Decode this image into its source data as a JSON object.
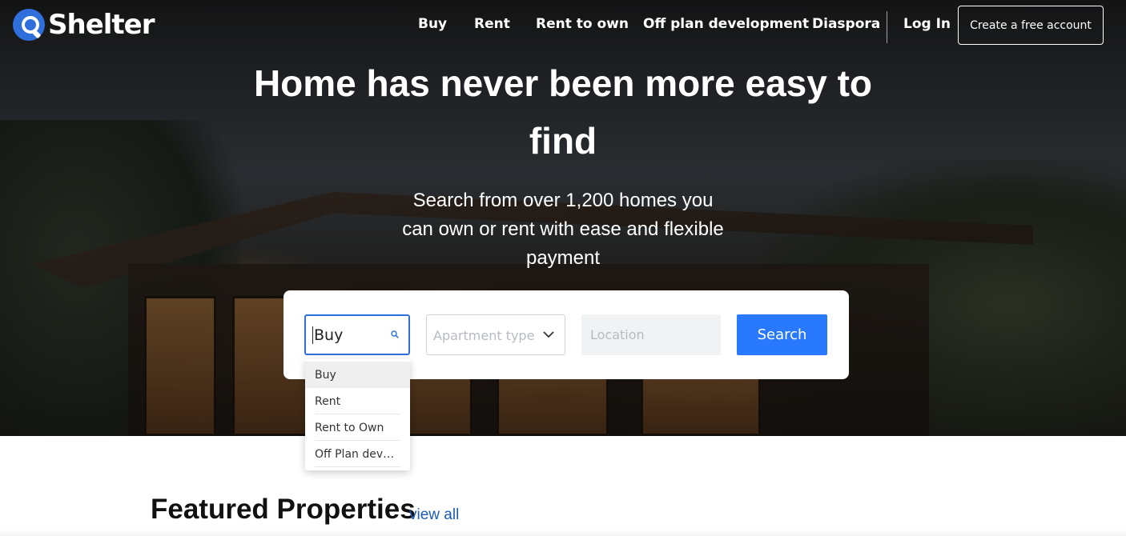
{
  "brand": {
    "name": "Shelter",
    "accent": "#2f6fdc",
    "button_blue": "#2979ff",
    "link_blue": "#1a5bb4"
  },
  "nav": {
    "items": [
      {
        "label": "Buy"
      },
      {
        "label": "Rent"
      },
      {
        "label": "Rent to own"
      },
      {
        "label": "Off plan development"
      },
      {
        "label": "Diaspora"
      }
    ],
    "login_label": "Log In",
    "create_account_label": "Create a free account"
  },
  "hero": {
    "title_lines": [
      "Home has never been more easy to",
      "find"
    ],
    "subtitle_lines": [
      "Search from over 1,200 homes you",
      "can own or rent with ease and flexible",
      "payment"
    ]
  },
  "search": {
    "type_value": "Buy",
    "type_icon": "search-icon",
    "apartment_placeholder": "Apartment type",
    "apartment_icon": "chevron-down-icon",
    "location_placeholder": "Location",
    "button_label": "Search"
  },
  "dropdown": {
    "options": [
      {
        "label": "Buy",
        "active": true
      },
      {
        "label": "Rent",
        "active": false
      },
      {
        "label": "Rent to Own",
        "active": false
      },
      {
        "label": "Off Plan devel...",
        "active": false
      }
    ]
  },
  "featured": {
    "title": "Featured Properties",
    "view_all_label": "view all"
  }
}
